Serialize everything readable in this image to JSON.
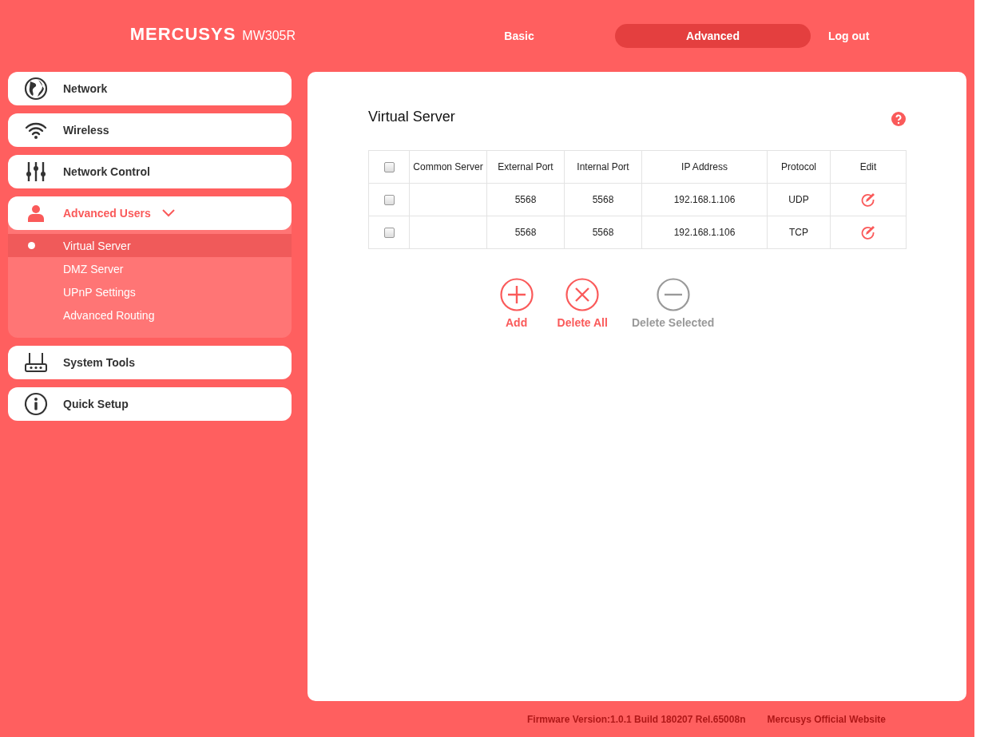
{
  "header": {
    "logo": "MERCUSYS",
    "model": "MW305R",
    "tabs": [
      {
        "label": "Basic",
        "selected": false
      },
      {
        "label": "Advanced",
        "selected": true
      }
    ],
    "logout": "Log out"
  },
  "sidebar": {
    "items": [
      {
        "label": "Network",
        "kind": "globe",
        "selected": false,
        "expanded": false
      },
      {
        "label": "Wireless",
        "kind": "wifi",
        "selected": false,
        "expanded": false
      },
      {
        "label": "Network Control",
        "kind": "sliders",
        "selected": false,
        "expanded": false
      },
      {
        "label": "Advanced Users",
        "kind": "user",
        "selected": true,
        "expanded": true,
        "children": [
          {
            "label": "Virtual Server",
            "selected": true
          },
          {
            "label": "DMZ Server",
            "selected": false
          },
          {
            "label": "UPnP Settings",
            "selected": false
          },
          {
            "label": "Advanced Routing",
            "selected": false
          }
        ]
      },
      {
        "label": "System Tools",
        "kind": "router",
        "selected": false,
        "expanded": false
      },
      {
        "label": "Quick Setup",
        "kind": "info",
        "selected": false,
        "expanded": false
      }
    ]
  },
  "panel": {
    "title": "Virtual Server",
    "table": {
      "header_checked": false,
      "columns": [
        "Common Server",
        "External Port",
        "Internal Port",
        "IP Address",
        "Protocol",
        "Edit"
      ],
      "rows": [
        {
          "checked": false,
          "external_port": "5568",
          "internal_port": "5568",
          "ip_address": "192.168.1.106",
          "protocol": "UDP"
        },
        {
          "checked": false,
          "external_port": "5568",
          "internal_port": "5568",
          "ip_address": "192.168.1.106",
          "protocol": "TCP"
        }
      ]
    },
    "actions": [
      {
        "label": "Add",
        "kind": "add",
        "disabled": false
      },
      {
        "label": "Delete All",
        "kind": "delete_all",
        "disabled": false
      },
      {
        "label": "Delete Selected",
        "kind": "delete_selected",
        "disabled": true
      }
    ]
  },
  "footer": {
    "firmware": "Firmware Version:1.0.1 Build 180207 Rel.65008n",
    "website": "Mercusys Official Website"
  }
}
